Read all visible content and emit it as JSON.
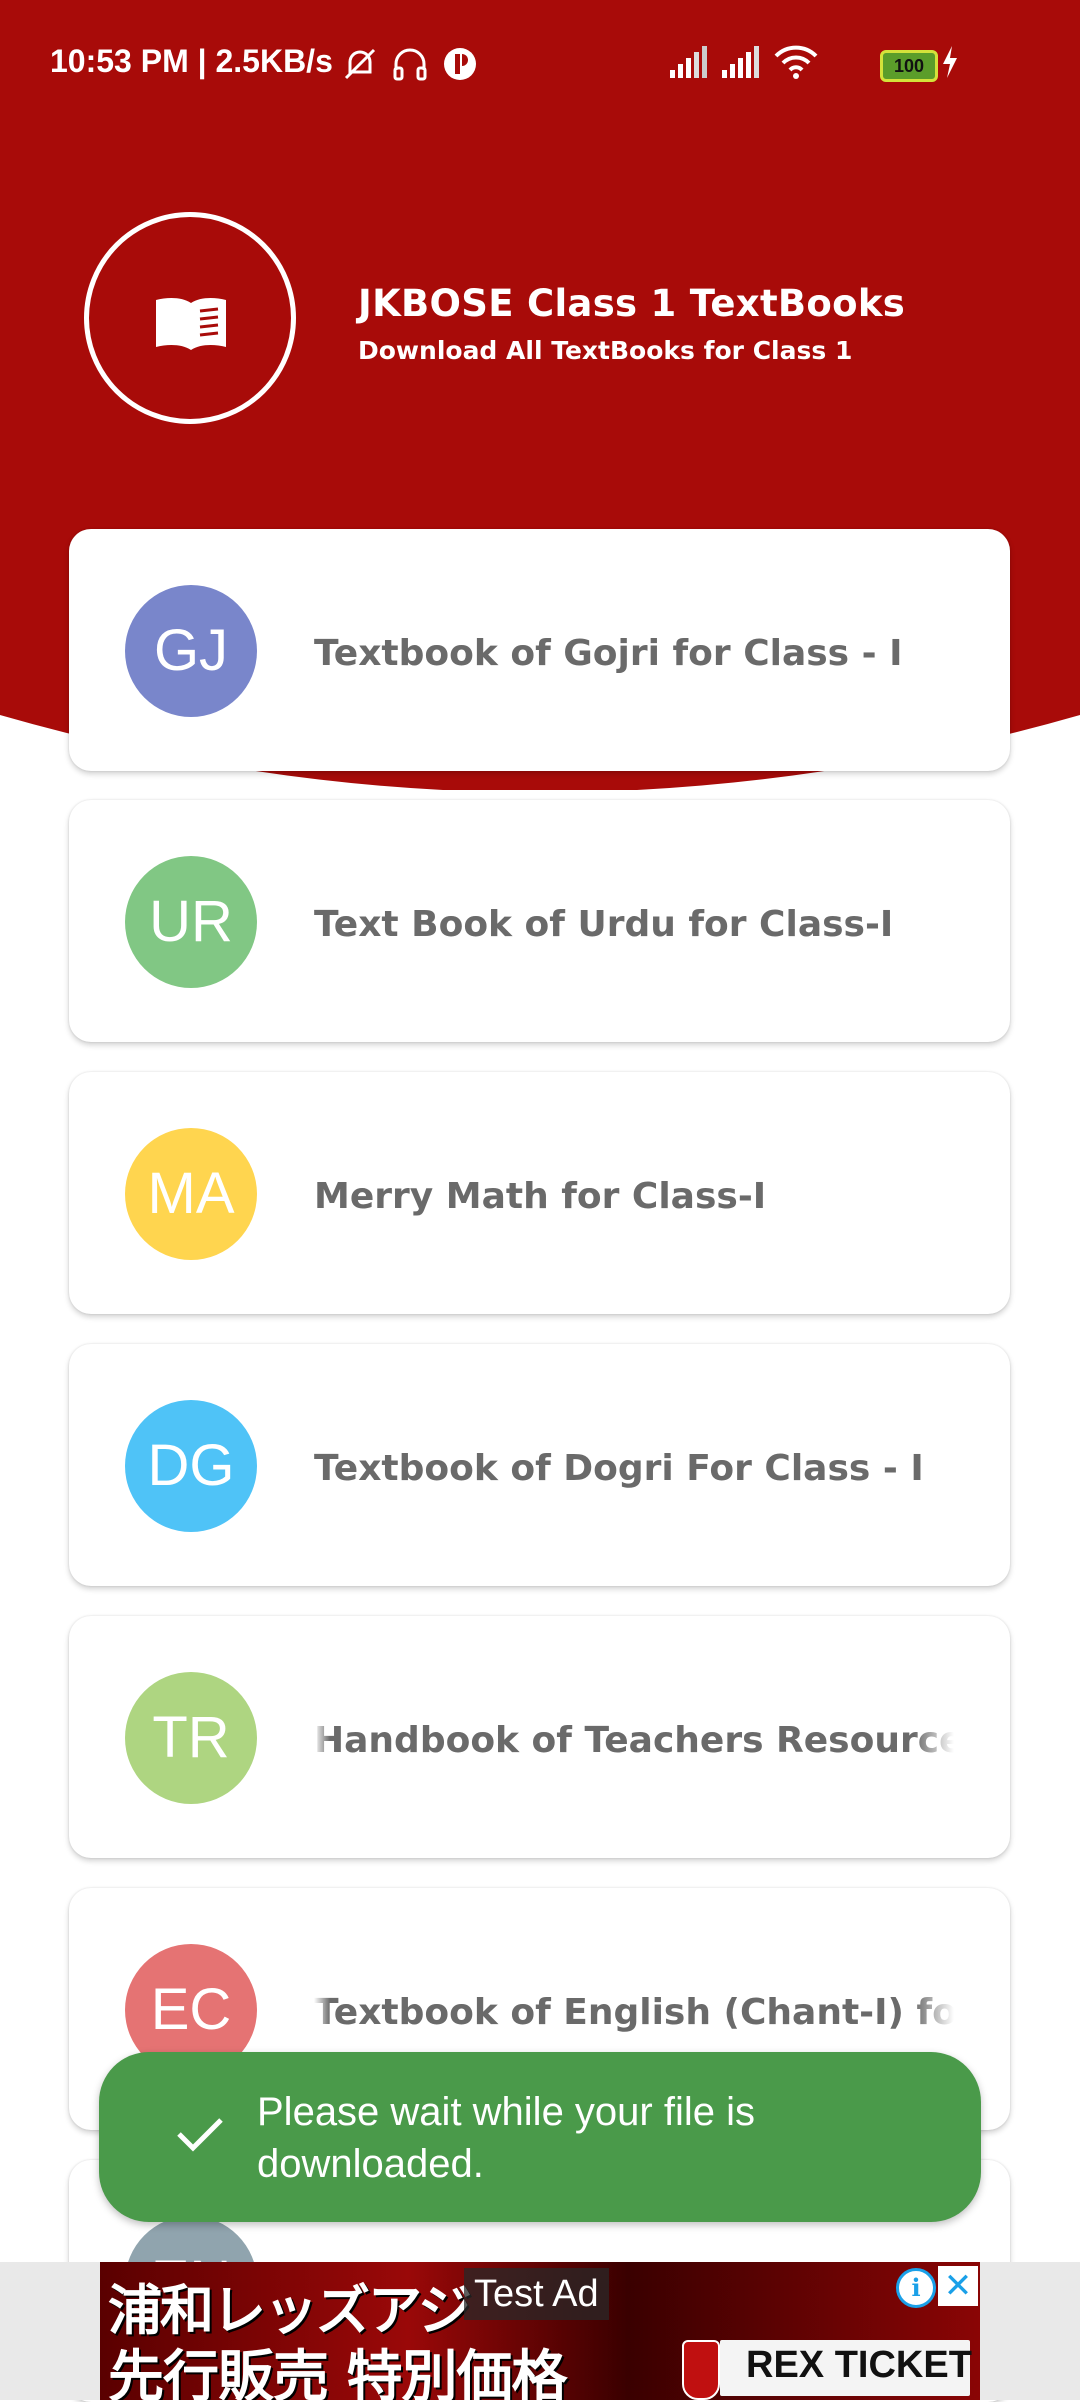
{
  "colors": {
    "header_red": "#a80b09",
    "toast_green": "#4a9a4a",
    "card_text": "#6a6a6a"
  },
  "status_bar": {
    "time": "10:53 PM | 2.5KB/s",
    "battery": "100",
    "icons": [
      "mute-icon",
      "headset-icon",
      "app-notification-icon",
      "signal-icon",
      "signal-icon",
      "wifi-icon",
      "battery-icon",
      "charging-icon"
    ]
  },
  "header": {
    "icon": "book-icon",
    "title": "JKBOSE Class 1 TextBooks",
    "subtitle": "Download All TextBooks for Class 1"
  },
  "books": [
    {
      "initials": "GJ",
      "title": "Textbook of Gojri for Class - I",
      "color": "#7986cb"
    },
    {
      "initials": "UR",
      "title": "Text Book of Urdu for Class-I",
      "color": "#81c784"
    },
    {
      "initials": "MA",
      "title": "Merry Math for Class-I",
      "color": "#ffd54f"
    },
    {
      "initials": "DG",
      "title": "Textbook of Dogri For Class - I",
      "color": "#4fc3f7"
    },
    {
      "initials": "TR",
      "title": "Handbook of Teachers Resources C",
      "color": "#aed581"
    },
    {
      "initials": "EC",
      "title": "Textbook of English (Chant-I) for C",
      "color": "#e57373"
    },
    {
      "initials": "EN",
      "title": "",
      "color": "#90a4ae"
    }
  ],
  "toast": {
    "icon": "check-icon",
    "message": "Please wait while your file is downloaded."
  },
  "ad": {
    "label": "Test Ad",
    "line1": "浦和レッズアジ",
    "line2": "先行販売 特別価格",
    "brand": "REX TICKET"
  }
}
